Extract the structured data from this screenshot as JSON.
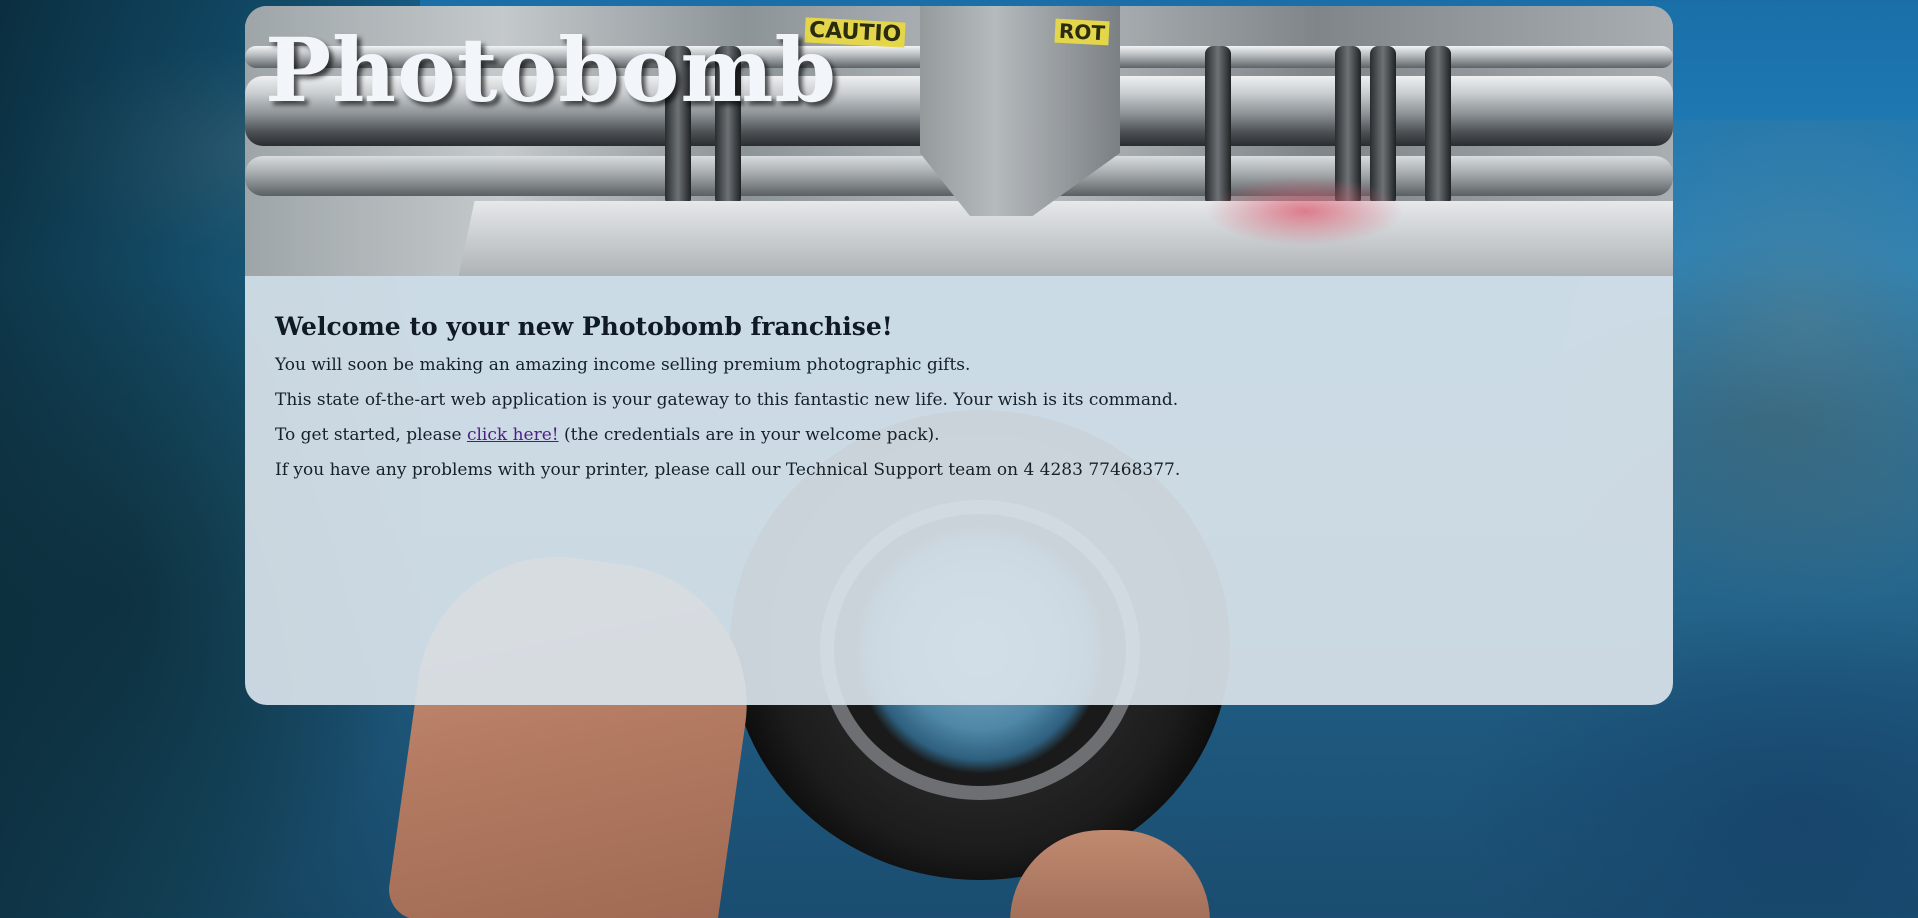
{
  "header": {
    "site_title": "Photobomb",
    "banner_labels": [
      "CAUTIO",
      "ROT"
    ]
  },
  "main": {
    "heading": "Welcome to your new Photobomb franchise!",
    "paragraph_1": "You will soon be making an amazing income selling premium photographic gifts.",
    "paragraph_2": "This state of-the-art web application is your gateway to this fantastic new life. Your wish is its command.",
    "paragraph_3_before": "To get started, please ",
    "paragraph_3_link": "click here!",
    "paragraph_3_after": " (the credentials are in your welcome pack).",
    "paragraph_4": "If you have any problems with your printer, please call our Technical Support team on 4 4283 77468377."
  },
  "colors": {
    "link": "#4c1f7e",
    "title": "#f2f6fa",
    "text": "#16202a"
  }
}
